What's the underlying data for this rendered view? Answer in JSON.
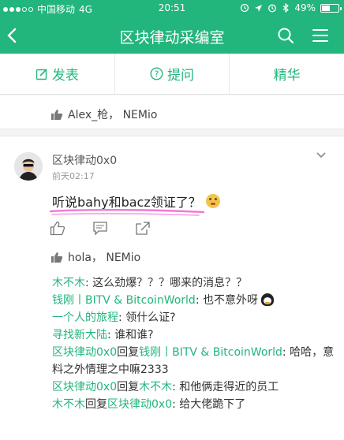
{
  "status_bar": {
    "carrier": "中国移动",
    "network": "4G",
    "time": "20:51",
    "battery": "49%",
    "battery_level": 0.49
  },
  "nav": {
    "title": "区块律动采编室"
  },
  "tabs": [
    {
      "label": "发表",
      "icon": "edit-icon"
    },
    {
      "label": "提问",
      "icon": "question-icon"
    },
    {
      "label": "精华"
    }
  ],
  "prev_likes": "Alex_枪， NEMio",
  "post": {
    "author": "区块律动0x0",
    "time": "前天02:17",
    "text": "听说bahy和bacz领证了？",
    "likes": "hola， NEMio"
  },
  "comments": [
    {
      "name": "木不木",
      "text": ": 这么劲爆？？？哪来的消息？？"
    },
    {
      "name": "钱刚丨BITV & BitcoinWorld",
      "text": ": 也不意外呀",
      "icon": "qq-penguin-icon"
    },
    {
      "name": "一个人的旅程",
      "text": ": 领什么证?"
    },
    {
      "name": "寻找新大陆",
      "text": ": 谁和谁?"
    },
    {
      "name": "区块律动0x0",
      "reply_word": "回复",
      "target": "钱刚丨BITV & BitcoinWorld",
      "text": ": 哈哈，意料之外情理之中嘛2333"
    },
    {
      "name": "区块律动0x0",
      "reply_word": "回复",
      "target": "木不木",
      "text": ": 和他俩走得近的员工"
    },
    {
      "name": "木不木",
      "reply_word": "回复",
      "target": "区块律动0x0",
      "text": ": 给大佬跪下了"
    }
  ],
  "colors": {
    "accent": "#22b57c"
  }
}
